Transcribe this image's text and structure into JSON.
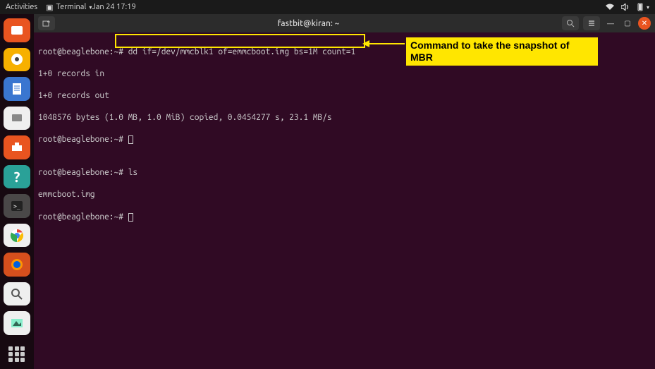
{
  "topbar": {
    "activities": "Activities",
    "app_label": "Terminal",
    "datetime": "Jan 24  17:19"
  },
  "window": {
    "title": "fastbit@kiran: ~"
  },
  "terminal": {
    "prompt1": "root@beaglebone:~# ",
    "cmd1": "dd if=/dev/mmcblk1 of=emmcboot.img bs=1M count=1",
    "out1": "1+0 records in",
    "out2": "1+0 records out",
    "out3": "1048576 bytes (1.0 MB, 1.0 MiB) copied, 0.0454277 s, 23.1 MB/s",
    "prompt2": "root@beaglebone:~# ",
    "blank": "",
    "prompt3": "root@beaglebone:~# ",
    "cmd3": "ls",
    "out4": "emmcboot.img",
    "prompt4": "root@beaglebone:~# "
  },
  "annotation": {
    "text": "Command to take the snapshot of MBR"
  },
  "dock_labels": {
    "files": "files-icon",
    "rhythmbox": "rhythmbox-icon",
    "writer": "writer-icon",
    "nautilus": "nautilus-icon",
    "software": "software-icon",
    "help": "help-icon",
    "terminal": "terminal-icon",
    "chrome": "chrome-icon",
    "firefox": "firefox-icon",
    "magnifier": "magnifier-icon",
    "shotwell": "shotwell-icon",
    "apps": "apps-icon"
  }
}
